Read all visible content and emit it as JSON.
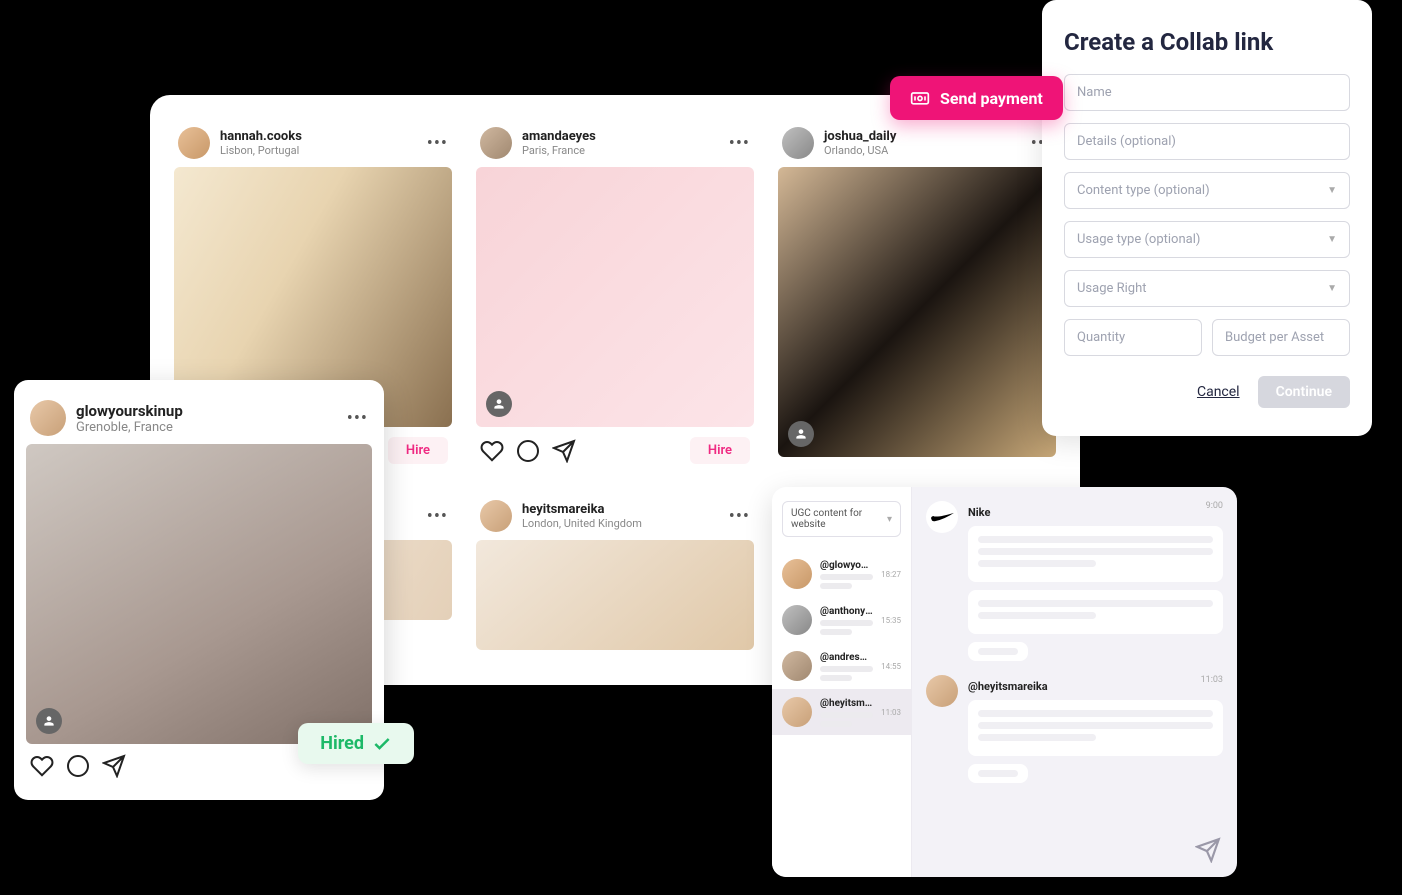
{
  "grid": {
    "posts": [
      {
        "username": "hannah.cooks",
        "location": "Lisbon, Portugal",
        "hire_label": "Hire"
      },
      {
        "username": "amandaeyes",
        "location": "Paris, France",
        "hire_label": "Hire"
      },
      {
        "username": "joshua_daily",
        "location": "Orlando, USA"
      },
      {
        "username": "heyitsmareika",
        "location": "London, United Kingdom"
      }
    ]
  },
  "featured": {
    "username": "glowyourskinup",
    "location": "Grenoble, France",
    "hired_label": "Hired"
  },
  "payment_button": "Send payment",
  "collab": {
    "title": "Create a Collab link",
    "fields": {
      "name": "Name",
      "details": "Details (optional)",
      "content_type": "Content type (optional)",
      "usage_type": "Usage type (optional)",
      "usage_right": "Usage Right",
      "quantity": "Quantity",
      "budget": "Budget per Asset"
    },
    "cancel": "Cancel",
    "continue": "Continue"
  },
  "chat": {
    "filter": "UGC content for website",
    "list": [
      {
        "handle": "@glowyoursk...",
        "time": "18:27"
      },
      {
        "handle": "@anthonyjuly",
        "time": "15:35"
      },
      {
        "handle": "@andresmora...",
        "time": "14:55"
      },
      {
        "handle": "@heyitsmareika",
        "time": "11:03"
      }
    ],
    "thread": [
      {
        "name": "Nike",
        "time": "9:00"
      },
      {
        "name": "@heyitsmareika",
        "time": "11:03"
      }
    ]
  }
}
